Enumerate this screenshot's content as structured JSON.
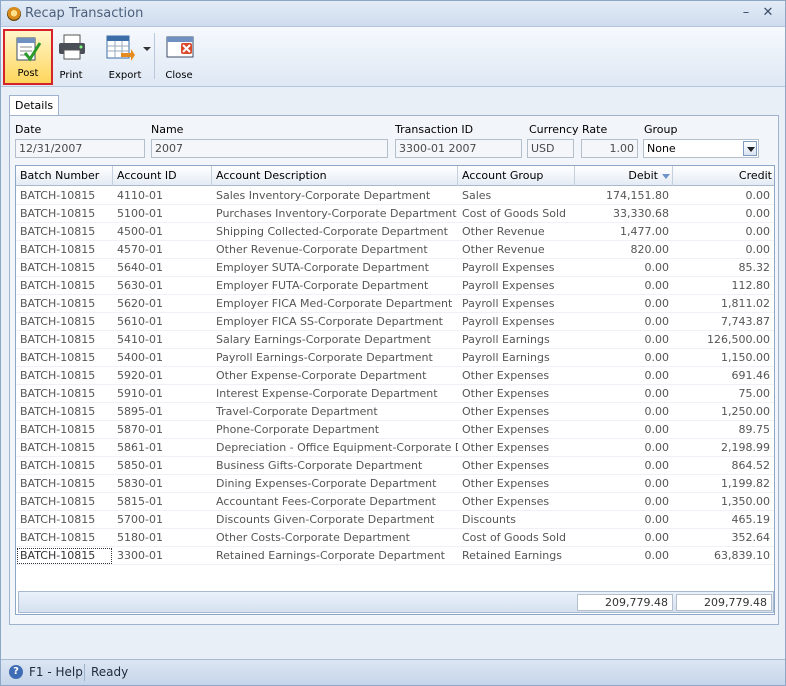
{
  "window": {
    "title": "Recap Transaction",
    "minimize_glyph": "–",
    "close_glyph": "✕"
  },
  "toolbar": {
    "post_label": "Post",
    "print_label": "Print",
    "export_label": "Export",
    "close_label": "Close"
  },
  "tabs": [
    {
      "label": "Details"
    }
  ],
  "form": {
    "date_label": "Date",
    "date_value": "12/31/2007",
    "name_label": "Name",
    "name_value": "2007",
    "txn_label": "Transaction ID",
    "txn_value": "3300-01 2007",
    "currency_label": "Currency",
    "currency_value": "USD",
    "rate_label": "Rate",
    "rate_value": "1.00",
    "group_label": "Group",
    "group_value": "None"
  },
  "grid": {
    "columns": [
      "Batch Number",
      "Account ID",
      "Account Description",
      "Account Group",
      "Debit",
      "Credit"
    ],
    "rows": [
      [
        "BATCH-10815",
        "4110-01",
        "Sales Inventory-Corporate Department",
        "Sales",
        "174,151.80",
        "0.00"
      ],
      [
        "BATCH-10815",
        "5100-01",
        "Purchases Inventory-Corporate Department",
        "Cost of Goods Sold",
        "33,330.68",
        "0.00"
      ],
      [
        "BATCH-10815",
        "4500-01",
        "Shipping Collected-Corporate Department",
        "Other Revenue",
        "1,477.00",
        "0.00"
      ],
      [
        "BATCH-10815",
        "4570-01",
        "Other Revenue-Corporate Department",
        "Other Revenue",
        "820.00",
        "0.00"
      ],
      [
        "BATCH-10815",
        "5640-01",
        "Employer SUTA-Corporate Department",
        "Payroll Expenses",
        "0.00",
        "85.32"
      ],
      [
        "BATCH-10815",
        "5630-01",
        "Employer FUTA-Corporate Department",
        "Payroll Expenses",
        "0.00",
        "112.80"
      ],
      [
        "BATCH-10815",
        "5620-01",
        "Employer FICA Med-Corporate Department",
        "Payroll Expenses",
        "0.00",
        "1,811.02"
      ],
      [
        "BATCH-10815",
        "5610-01",
        "Employer FICA SS-Corporate Department",
        "Payroll Expenses",
        "0.00",
        "7,743.87"
      ],
      [
        "BATCH-10815",
        "5410-01",
        "Salary Earnings-Corporate Department",
        "Payroll Earnings",
        "0.00",
        "126,500.00"
      ],
      [
        "BATCH-10815",
        "5400-01",
        "Payroll Earnings-Corporate Department",
        "Payroll Earnings",
        "0.00",
        "1,150.00"
      ],
      [
        "BATCH-10815",
        "5920-01",
        "Other Expense-Corporate Department",
        "Other Expenses",
        "0.00",
        "691.46"
      ],
      [
        "BATCH-10815",
        "5910-01",
        "Interest Expense-Corporate Department",
        "Other Expenses",
        "0.00",
        "75.00"
      ],
      [
        "BATCH-10815",
        "5895-01",
        "Travel-Corporate Department",
        "Other Expenses",
        "0.00",
        "1,250.00"
      ],
      [
        "BATCH-10815",
        "5870-01",
        "Phone-Corporate Department",
        "Other Expenses",
        "0.00",
        "89.75"
      ],
      [
        "BATCH-10815",
        "5861-01",
        "Depreciation - Office Equipment-Corporate Depart",
        "Other Expenses",
        "0.00",
        "2,198.99"
      ],
      [
        "BATCH-10815",
        "5850-01",
        "Business Gifts-Corporate Department",
        "Other Expenses",
        "0.00",
        "864.52"
      ],
      [
        "BATCH-10815",
        "5830-01",
        "Dining Expenses-Corporate Department",
        "Other Expenses",
        "0.00",
        "1,199.82"
      ],
      [
        "BATCH-10815",
        "5815-01",
        "Accountant Fees-Corporate Department",
        "Other Expenses",
        "0.00",
        "1,350.00"
      ],
      [
        "BATCH-10815",
        "5700-01",
        "Discounts Given-Corporate Department",
        "Discounts",
        "0.00",
        "465.19"
      ],
      [
        "BATCH-10815",
        "5180-01",
        "Other Costs-Corporate Department",
        "Cost of Goods Sold",
        "0.00",
        "352.64"
      ],
      [
        "BATCH-10815",
        "3300-01",
        "Retained Earnings-Corporate Department",
        "Retained Earnings",
        "0.00",
        "63,839.10"
      ]
    ],
    "total_debit": "209,779.48",
    "total_credit": "209,779.48"
  },
  "status": {
    "help": "F1 - Help",
    "state": "Ready"
  },
  "colors": {
    "accent_border": "#d6232a",
    "chrome": "#dfe8f4"
  }
}
